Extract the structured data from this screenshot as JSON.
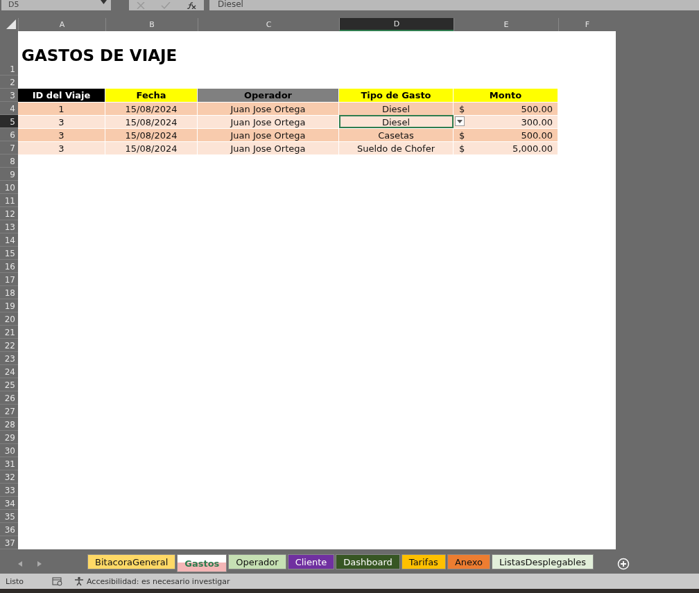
{
  "formula_bar": {
    "name_box": "D5",
    "value": "Diesel"
  },
  "columns": [
    {
      "label": "A",
      "selected": false
    },
    {
      "label": "B",
      "selected": false
    },
    {
      "label": "C",
      "selected": false
    },
    {
      "label": "D",
      "selected": true
    },
    {
      "label": "E",
      "selected": false
    },
    {
      "label": "F",
      "selected": false
    }
  ],
  "row_numbers": [
    {
      "label": "1",
      "selected": false
    },
    {
      "label": "2",
      "selected": false
    },
    {
      "label": "3",
      "selected": false
    },
    {
      "label": "4",
      "selected": false
    },
    {
      "label": "5",
      "selected": true
    },
    {
      "label": "6",
      "selected": false
    },
    {
      "label": "7",
      "selected": false
    },
    {
      "label": "8",
      "selected": false
    },
    {
      "label": "9",
      "selected": false
    },
    {
      "label": "10",
      "selected": false
    },
    {
      "label": "11",
      "selected": false
    },
    {
      "label": "12",
      "selected": false
    },
    {
      "label": "13",
      "selected": false
    },
    {
      "label": "14",
      "selected": false
    },
    {
      "label": "15",
      "selected": false
    },
    {
      "label": "16",
      "selected": false
    },
    {
      "label": "17",
      "selected": false
    },
    {
      "label": "18",
      "selected": false
    },
    {
      "label": "19",
      "selected": false
    },
    {
      "label": "20",
      "selected": false
    },
    {
      "label": "21",
      "selected": false
    },
    {
      "label": "22",
      "selected": false
    },
    {
      "label": "23",
      "selected": false
    },
    {
      "label": "24",
      "selected": false
    },
    {
      "label": "25",
      "selected": false
    },
    {
      "label": "26",
      "selected": false
    },
    {
      "label": "27",
      "selected": false
    },
    {
      "label": "28",
      "selected": false
    },
    {
      "label": "29",
      "selected": false
    },
    {
      "label": "30",
      "selected": false
    },
    {
      "label": "31",
      "selected": false
    },
    {
      "label": "32",
      "selected": false
    },
    {
      "label": "33",
      "selected": false
    },
    {
      "label": "34",
      "selected": false
    },
    {
      "label": "35",
      "selected": false
    },
    {
      "label": "36",
      "selected": false
    },
    {
      "label": "37",
      "selected": false
    }
  ],
  "sheet": {
    "title": "GASTOS DE VIAJE",
    "headers": [
      {
        "label": "ID del Viaje",
        "color": "#000000"
      },
      {
        "label": "Fecha",
        "color": "#ffff00"
      },
      {
        "label": "Operador",
        "color": "#808080"
      },
      {
        "label": "Tipo de Gasto",
        "color": "#ffff00"
      },
      {
        "label": "Monto",
        "color": "#ffff00"
      }
    ],
    "rows": [
      {
        "color": "#f8cbad",
        "cells": [
          "1",
          "15/08/2024",
          "Juan Jose Ortega",
          "Diesel"
        ],
        "currency": "$",
        "amount": "500.00"
      },
      {
        "color": "#fce4d6",
        "cells": [
          "3",
          "15/08/2024",
          "Juan Jose Ortega",
          "Diesel"
        ],
        "amount": "300.00"
      },
      {
        "color": "#f8cbad",
        "cells": [
          "3",
          "15/08/2024",
          "Juan Jose Ortega",
          "Casetas"
        ],
        "currency": "$",
        "amount": "500.00"
      },
      {
        "color": "#fce4d6",
        "cells": [
          "3",
          "15/08/2024",
          "Juan Jose Ortega",
          "Sueldo de Chofer"
        ],
        "currency": "$",
        "amount": "5,000.00"
      }
    ]
  },
  "sheet_tabs": [
    {
      "label": "BitacoraGeneral",
      "color": "#ffd966",
      "selected": false
    },
    {
      "label": "Gastos",
      "color": "#f4b6b6",
      "selected": true
    },
    {
      "label": "Operador",
      "color": "#c6e0b4",
      "selected": false
    },
    {
      "label": "Cliente",
      "color": "#7030a0",
      "selected": false
    },
    {
      "label": "Dashboard",
      "color": "#375623",
      "selected": false
    },
    {
      "label": "Tarifas",
      "color": "#ffc000",
      "selected": false
    },
    {
      "label": "Anexo",
      "color": "#ed7d31",
      "selected": false
    },
    {
      "label": "ListasDesplegables",
      "color": "#e2efda",
      "selected": false
    }
  ],
  "status_bar": {
    "mode": "Listo",
    "accessibility": "Accesibilidad: es necesario investigar"
  }
}
